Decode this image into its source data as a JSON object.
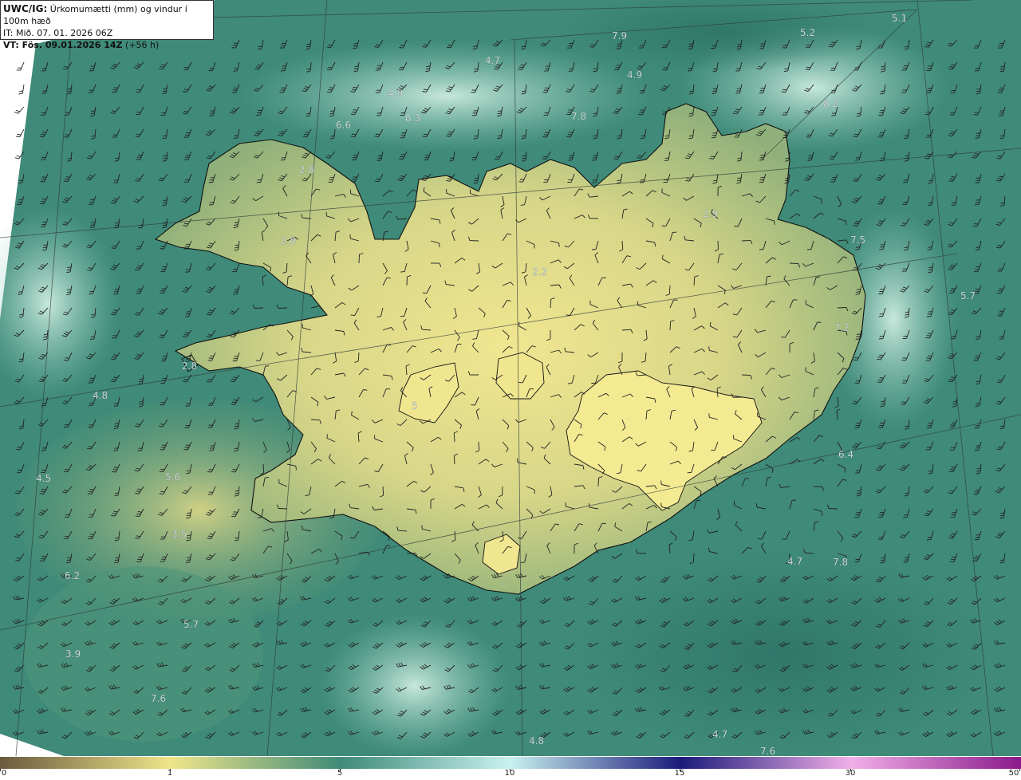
{
  "header": {
    "product": "UWC/IG:",
    "title": "Úrkomumætti (mm) og vindur í 100m hæð",
    "init_time": "IT: Mið. 07. 01. 2026 06Z",
    "valid_prefix": "VT: Fös. 09.01.2026 14Z",
    "valid_offset": "(+56 h)"
  },
  "colorbar": {
    "stops": [
      {
        "value": "0",
        "color": "#6b5a3e"
      },
      {
        "value": "1",
        "color": "#f0e68a"
      },
      {
        "value": "5",
        "color": "#3f8a78"
      },
      {
        "value": "10",
        "color": "#c9f2f0"
      },
      {
        "value": "15",
        "color": "#1a1a7a"
      },
      {
        "value": "30",
        "color": "#f2b0e8"
      },
      {
        "value": "50",
        "color": "#8a1a8a"
      }
    ],
    "tick_labels": [
      "0",
      "1",
      "5",
      "10",
      "15",
      "30",
      "50"
    ]
  },
  "map": {
    "colors": {
      "ocean": "#3f8a78",
      "land_dry": "#e7dc86",
      "land_mid": "#9fb47c",
      "highland": "#f1e690",
      "showers": "#cdeedb",
      "coast": "#111111",
      "grid": "#333333",
      "barb": "#222222"
    },
    "value_labels": [
      "5.1",
      "7.9",
      "5.2",
      "4.7",
      "4.9",
      "4.9",
      "8.3",
      "7.8",
      "8.2",
      "6.6",
      "2.8",
      "2.9",
      "2.8",
      "2.2",
      "7.5",
      "5.7",
      "7.2",
      "2.8",
      "4.8",
      "5",
      "6.4",
      "4.5",
      "5.6",
      "3.5",
      "6.2",
      "5.7",
      "3.9",
      "7.6",
      "4.7",
      "7.8",
      "4.8",
      "4.7",
      "7.6"
    ]
  }
}
